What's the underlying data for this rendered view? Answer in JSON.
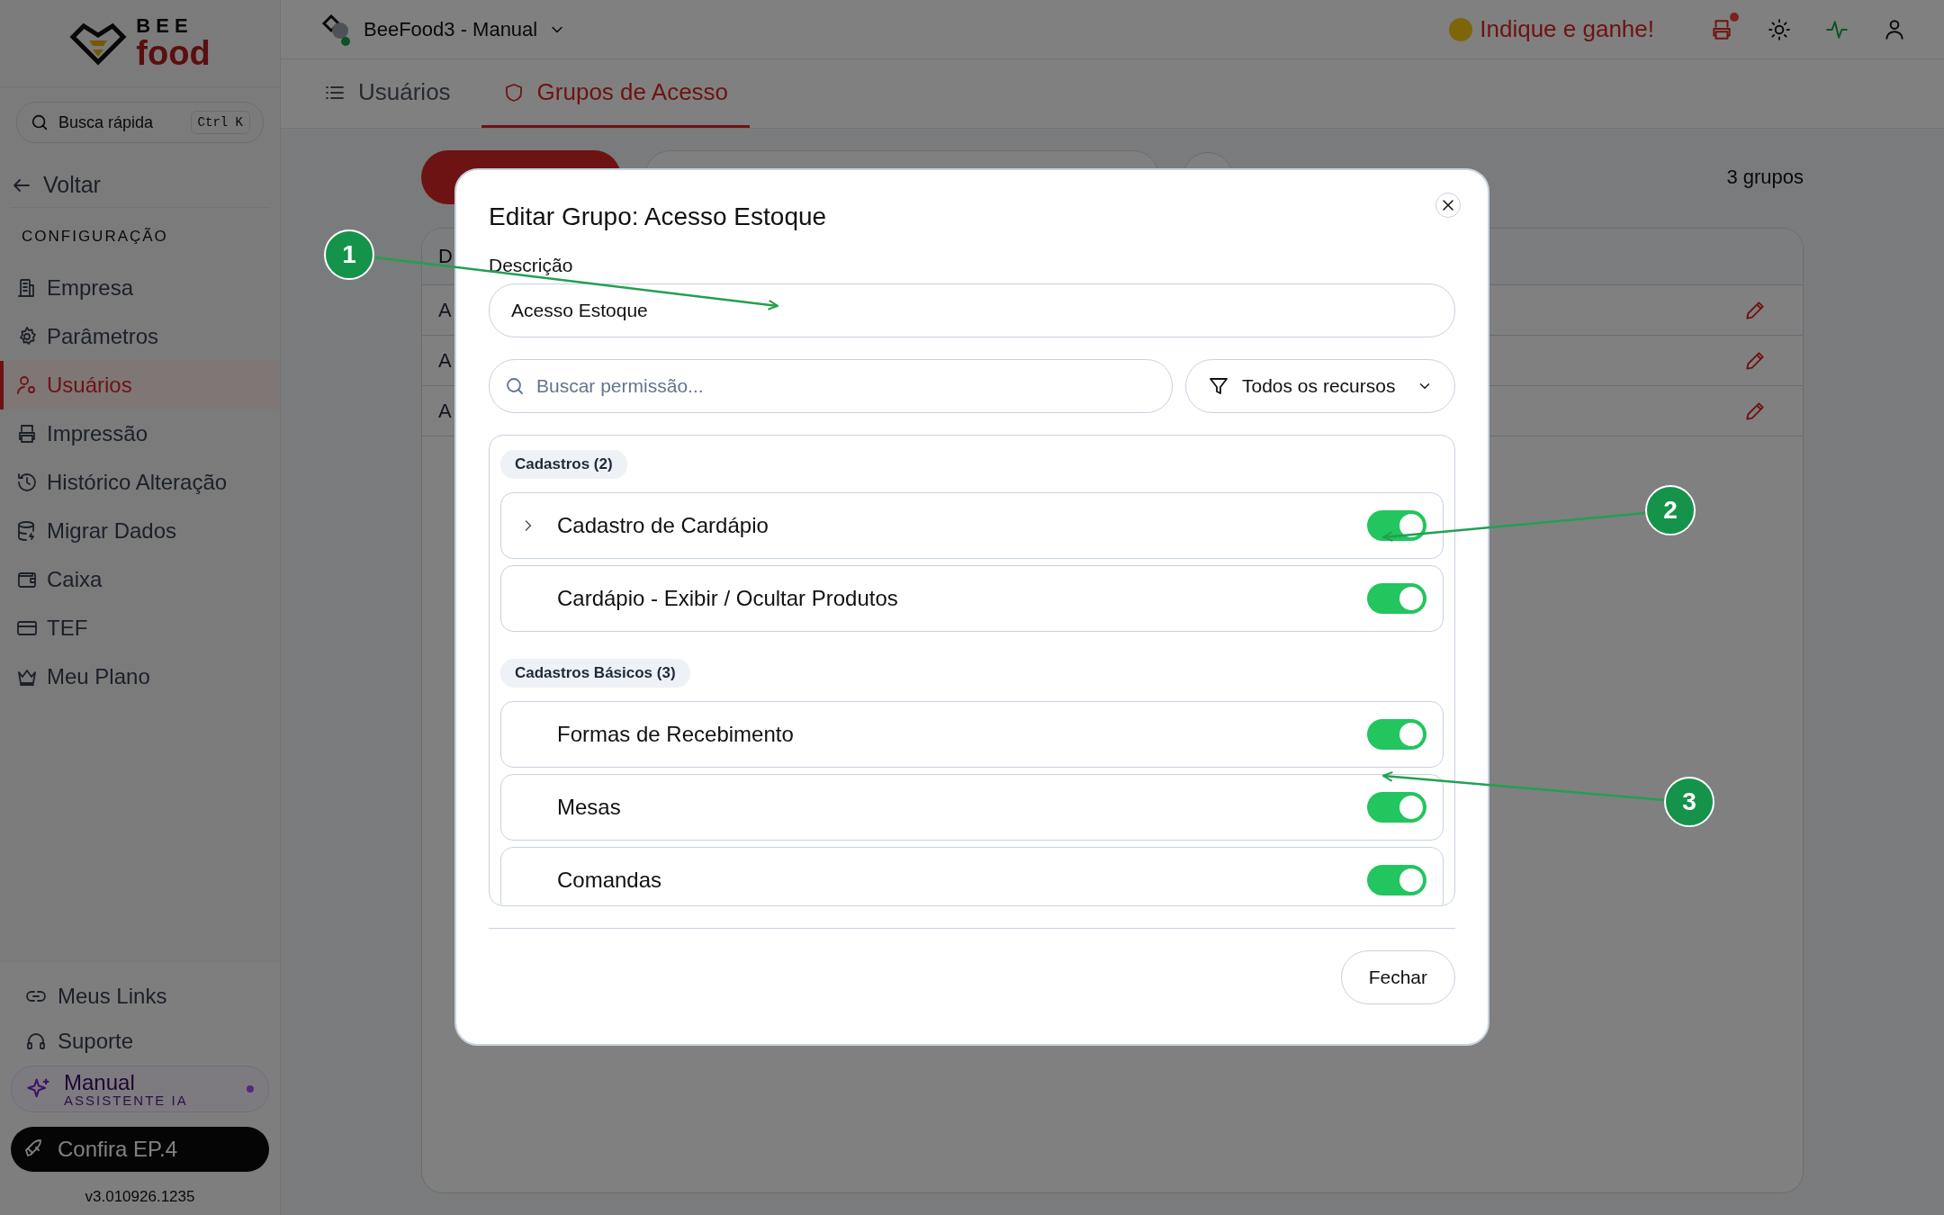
{
  "sidebar": {
    "logo": {
      "line1": "BEE",
      "line2": "food"
    },
    "quick_search": {
      "placeholder": "Busca rápida",
      "shortcut": "Ctrl K"
    },
    "back": "Voltar",
    "section": "CONFIGURAÇÃO",
    "items": [
      {
        "label": "Empresa",
        "selected": false
      },
      {
        "label": "Parâmetros",
        "selected": false
      },
      {
        "label": "Usuários",
        "selected": true
      },
      {
        "label": "Impressão",
        "selected": false
      },
      {
        "label": "Histórico Alteração",
        "selected": false
      },
      {
        "label": "Migrar Dados",
        "selected": false
      },
      {
        "label": "Caixa",
        "selected": false
      },
      {
        "label": "TEF",
        "selected": false
      },
      {
        "label": "Meu Plano",
        "selected": false
      }
    ],
    "footer_links": [
      "Meus Links",
      "Suporte"
    ],
    "assistant": {
      "title": "Manual",
      "subtitle": "ASSISTENTE IA"
    },
    "promo": "Confira EP.4",
    "version": "v3.010926.1235"
  },
  "topbar": {
    "workspace": "BeeFood3 - Manual",
    "referral": "Indique e ganhe!"
  },
  "tabs": [
    {
      "label": "Usuários",
      "selected": false
    },
    {
      "label": "Grupos de Acesso",
      "selected": true
    }
  ],
  "content": {
    "count": "3 grupos",
    "table": {
      "columns": [
        "D"
      ],
      "rows": [
        [
          "A"
        ],
        [
          "A"
        ],
        [
          "A"
        ]
      ]
    }
  },
  "modal": {
    "title": "Editar Grupo: Acesso Estoque",
    "description_label": "Descrição",
    "description_value": "Acesso Estoque",
    "search": {
      "placeholder": "Buscar permissão..."
    },
    "filter": "Todos os recursos",
    "groups": [
      {
        "label": "Cadastros (2)",
        "permissions": [
          {
            "name": "Cadastro de Cardápio",
            "has_children": true,
            "on": true
          },
          {
            "name": "Cardápio - Exibir / Ocultar Produtos",
            "has_children": false,
            "on": true
          }
        ]
      },
      {
        "label": "Cadastros Básicos (3)",
        "permissions": [
          {
            "name": "Formas de Recebimento",
            "has_children": false,
            "on": true
          },
          {
            "name": "Mesas",
            "has_children": false,
            "on": true
          },
          {
            "name": "Comandas",
            "has_children": false,
            "on": true
          }
        ]
      }
    ],
    "close_button": "Fechar"
  },
  "annotations": [
    "1",
    "2",
    "3"
  ]
}
